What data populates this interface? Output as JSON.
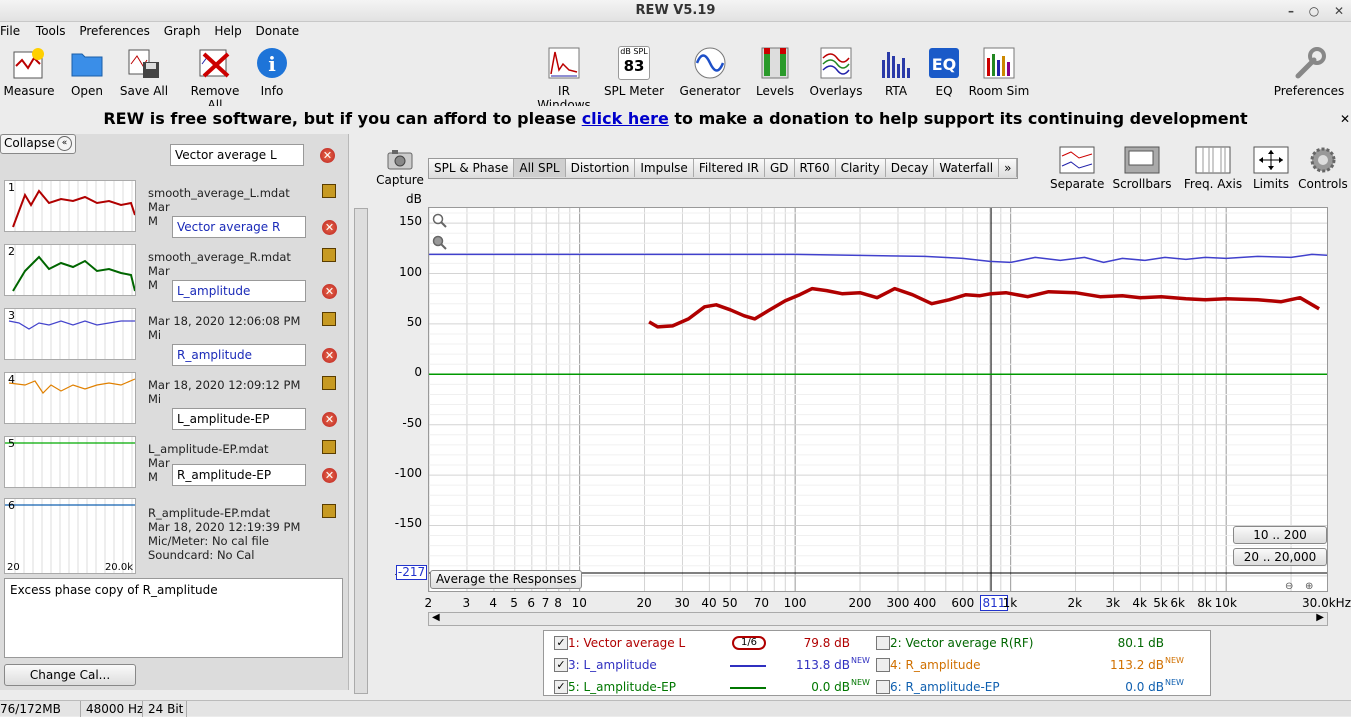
{
  "window": {
    "title": "REW V5.19"
  },
  "menu": [
    "File",
    "Tools",
    "Preferences",
    "Graph",
    "Help",
    "Donate"
  ],
  "toolbar": {
    "measure": "Measure",
    "open": "Open",
    "save_all": "Save All",
    "remove_all": "Remove All",
    "info": "Info",
    "ir_windows": "IR Windows",
    "spl_meter": "SPL Meter",
    "spl_top": "dB SPL",
    "spl_value": "83",
    "generator": "Generator",
    "levels": "Levels",
    "overlays": "Overlays",
    "rta": "RTA",
    "eq": "EQ",
    "room_sim": "Room Sim",
    "preferences": "Preferences"
  },
  "banner": {
    "pre": "REW is free software, but if you can afford to please ",
    "link": "click here",
    "post": " to make a donation to help support its continuing development"
  },
  "left": {
    "collapse": "Collapse",
    "measurements": [
      {
        "num": "1",
        "name": "Vector average L",
        "file": "smooth_average_L.mdat",
        "line2": "Mar",
        "line3": "M"
      },
      {
        "num": "2",
        "name": "Vector average R",
        "file": "smooth_average_R.mdat",
        "line2": "Mar",
        "line3": "M"
      },
      {
        "num": "3",
        "name": "L_amplitude",
        "file": "Mar 18, 2020 12:06:08 PM",
        "line2": "Mi",
        "line3": ""
      },
      {
        "num": "4",
        "name": "R_amplitude",
        "file": "Mar 18, 2020 12:09:12 PM",
        "line2": "Mi",
        "line3": ""
      },
      {
        "num": "5",
        "name": "L_amplitude-EP",
        "file": "L_amplitude-EP.mdat",
        "line2": "Mar",
        "line3": "M"
      },
      {
        "num": "6",
        "name": "R_amplitude-EP",
        "file": "R_amplitude-EP.mdat",
        "line2": "Mar 18, 2020 12:19:39 PM",
        "line3": "Mic/Meter: No cal file",
        "line4": "Soundcard: No Cal"
      }
    ],
    "thumb_axis_min": "20",
    "thumb_axis_max": "20.0k",
    "notes": "Excess phase copy of R_amplitude",
    "change_cal": "Change Cal..."
  },
  "graph": {
    "capture": "Capture",
    "tabs": [
      "SPL & Phase",
      "All SPL",
      "Distortion",
      "Impulse",
      "Filtered IR",
      "GD",
      "RT60",
      "Clarity",
      "Decay",
      "Waterfall",
      "»"
    ],
    "active_tab": "All SPL",
    "right_tools": [
      "Separate",
      "Scrollbars",
      "Freq. Axis",
      "Limits",
      "Controls"
    ],
    "y_unit": "dB",
    "y_ticks": [
      "150",
      "100",
      "50",
      "0",
      "-50",
      "-100",
      "-150",
      "-200"
    ],
    "y_cursor": "-217",
    "x_ticks": [
      "2",
      "3",
      "4",
      "5",
      "6",
      "7",
      "8",
      "10",
      "20",
      "30",
      "40",
      "50",
      "70",
      "100",
      "200",
      "300",
      "400",
      "600",
      "811",
      "1k",
      "2k",
      "3k",
      "4k",
      "5k",
      "6k",
      "8k",
      "10k",
      "30.0kHz"
    ],
    "average_btn": "Average the Responses",
    "range1": "10 .. 200",
    "range2": "20 .. 20,000"
  },
  "chart_data": {
    "type": "line",
    "x_scale": "log",
    "xlim": [
      2,
      30000
    ],
    "ylim": [
      -217,
      165
    ],
    "cursor_x": 811,
    "series": [
      {
        "name": "1: Vector average L",
        "color": "#b00000",
        "points": [
          [
            21,
            52
          ],
          [
            23,
            47
          ],
          [
            27,
            48
          ],
          [
            32,
            55
          ],
          [
            38,
            67
          ],
          [
            43,
            69
          ],
          [
            50,
            64
          ],
          [
            58,
            58
          ],
          [
            65,
            55
          ],
          [
            75,
            63
          ],
          [
            90,
            73
          ],
          [
            105,
            79
          ],
          [
            120,
            85
          ],
          [
            140,
            83
          ],
          [
            165,
            80
          ],
          [
            200,
            81
          ],
          [
            240,
            76
          ],
          [
            290,
            85
          ],
          [
            350,
            79
          ],
          [
            430,
            70
          ],
          [
            520,
            74
          ],
          [
            620,
            79
          ],
          [
            720,
            78
          ],
          [
            811,
            80
          ],
          [
            950,
            81
          ],
          [
            1200,
            77
          ],
          [
            1500,
            82
          ],
          [
            2000,
            81
          ],
          [
            2600,
            77
          ],
          [
            3300,
            78
          ],
          [
            4000,
            76
          ],
          [
            5000,
            77
          ],
          [
            6500,
            75
          ],
          [
            8000,
            74
          ],
          [
            10000,
            75
          ],
          [
            14000,
            74
          ],
          [
            18000,
            72
          ],
          [
            22000,
            76
          ],
          [
            27000,
            65
          ]
        ]
      },
      {
        "name": "3: L_amplitude",
        "color": "#4040cc",
        "points": [
          [
            2,
            119
          ],
          [
            20,
            119
          ],
          [
            100,
            119
          ],
          [
            200,
            118
          ],
          [
            400,
            117
          ],
          [
            600,
            115
          ],
          [
            800,
            112
          ],
          [
            1000,
            111
          ],
          [
            1300,
            116
          ],
          [
            1700,
            113
          ],
          [
            2200,
            116
          ],
          [
            2700,
            111
          ],
          [
            3300,
            115
          ],
          [
            4200,
            113
          ],
          [
            5200,
            116
          ],
          [
            6500,
            114
          ],
          [
            8000,
            116
          ],
          [
            10000,
            115
          ],
          [
            14000,
            117
          ],
          [
            20000,
            116
          ],
          [
            25000,
            119
          ],
          [
            30000,
            118
          ]
        ]
      },
      {
        "name": "5: L_amplitude-EP",
        "color": "#009900",
        "points": [
          [
            2,
            0
          ],
          [
            30000,
            0
          ]
        ]
      }
    ]
  },
  "legend": [
    {
      "label": "1: Vector average L",
      "color": "#b00000",
      "checked": true,
      "value": "79.8 dB",
      "new": "",
      "smooth": "1/6"
    },
    {
      "label": "2: Vector average R(RF)",
      "color": "#006600",
      "checked": false,
      "value": "80.1 dB",
      "new": ""
    },
    {
      "label": "3: L_amplitude",
      "color": "#3030c0",
      "checked": true,
      "value": "113.8 dB",
      "new": "NEW"
    },
    {
      "label": "4: R_amplitude",
      "color": "#d07000",
      "checked": false,
      "value": "113.2 dB",
      "new": "NEW"
    },
    {
      "label": "5: L_amplitude-EP",
      "color": "#007700",
      "checked": true,
      "value": "0.0 dB",
      "new": "NEW"
    },
    {
      "label": "6: R_amplitude-EP",
      "color": "#1060b0",
      "checked": false,
      "value": "0.0 dB",
      "new": "NEW"
    }
  ],
  "status": {
    "memory": "76/172MB",
    "rate": "48000 Hz",
    "bits": "24 Bit"
  }
}
